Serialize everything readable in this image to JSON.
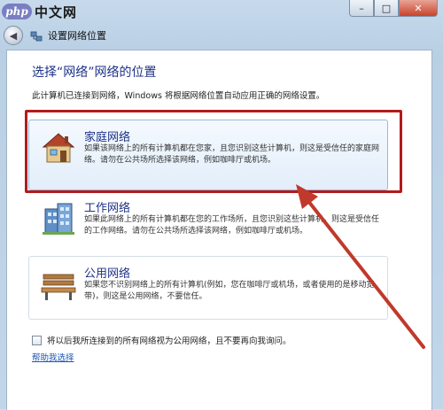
{
  "watermark": {
    "logo": "php",
    "text": "中文网"
  },
  "window": {
    "title": "设置网络位置",
    "min_glyph": "–",
    "max_glyph": "□",
    "close_glyph": "✕"
  },
  "content": {
    "heading": "选择“网络”网络的位置",
    "description": "此计算机已连接到网络，Windows 将根据网络位置自动应用正确的网络设置。",
    "options": [
      {
        "title": "家庭网络",
        "icon": "house-icon",
        "text": "如果该网络上的所有计算机都在您家，且您识别这些计算机，则这是受信任的家庭网络。请勿在公共场所选择该网络，例如咖啡厅或机场。"
      },
      {
        "title": "工作网络",
        "icon": "office-building-icon",
        "text": "如果此网络上的所有计算机都在您的工作场所，且您识别这些计算机，则这是受信任的工作网络。请勿在公共场所选择该网络，例如咖啡厅或机场。"
      },
      {
        "title": "公用网络",
        "icon": "park-bench-icon",
        "text": "如果您不识别网络上的所有计算机(例如，您在咖啡厅或机场，或者使用的是移动宽带)，则这是公用网络，不要信任。"
      }
    ],
    "checkbox_label": "将以后我所连接到的所有网络视为公用网络，且不要再向我询问。",
    "checkbox_checked": false,
    "help_link": "帮助我选择"
  },
  "colors": {
    "heading": "#1e3287",
    "highlight_border": "#b21b1b",
    "arrow": "#c0392b"
  }
}
